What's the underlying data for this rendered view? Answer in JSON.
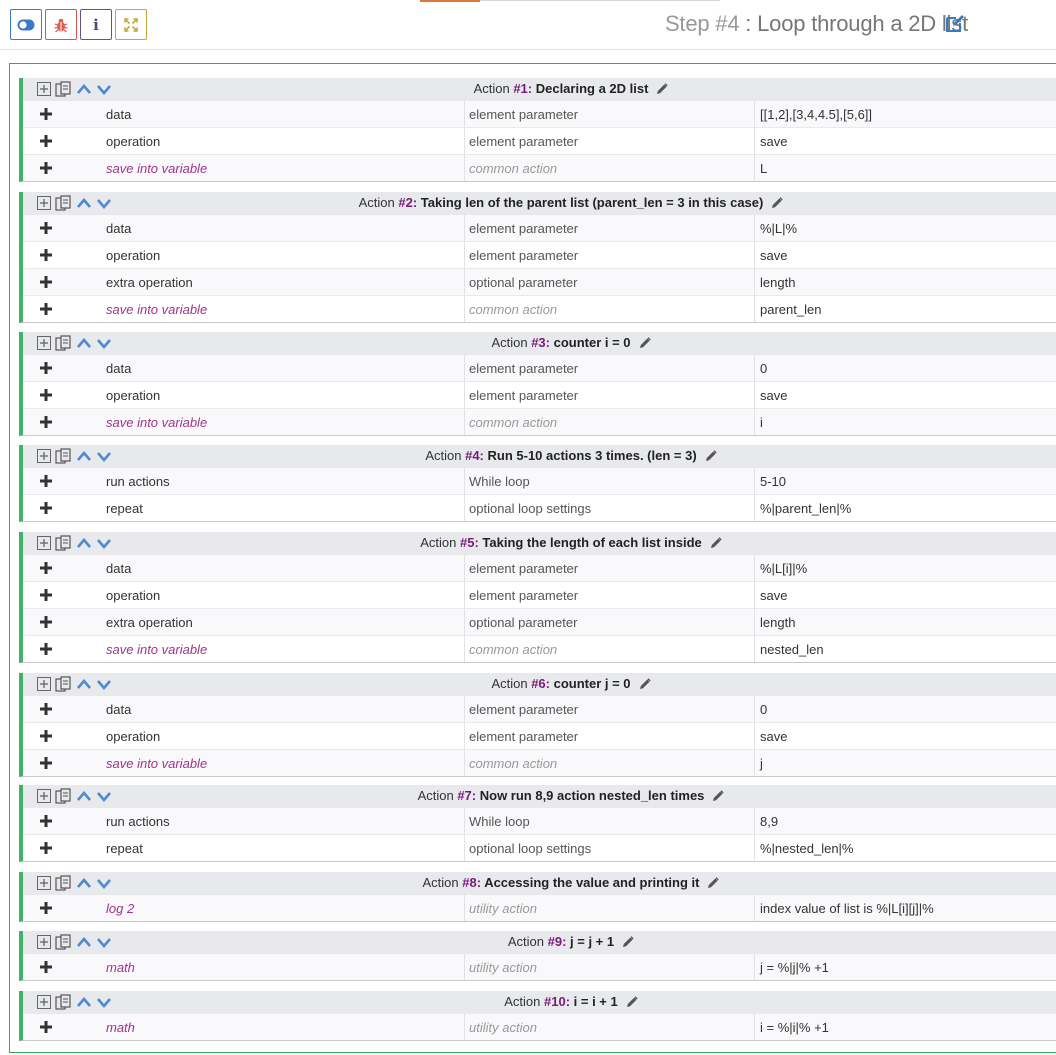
{
  "toolbar": {
    "buttons": [
      {
        "name": "toggle-icon",
        "color": "#3a79c4"
      },
      {
        "name": "bug-icon",
        "color": "#d9534f"
      },
      {
        "name": "info-icon",
        "glyph": "i",
        "color": "#5b5b8a"
      },
      {
        "name": "expand-icon",
        "color": "#c9a43a"
      }
    ]
  },
  "step": {
    "number": "Step #4",
    "separator": " : ",
    "title": "Loop through a 2D list"
  },
  "actions": [
    {
      "label": "Action",
      "num": "#1:",
      "name": "Declaring a 2D list",
      "rows": [
        {
          "field": "data",
          "type": "element parameter",
          "value": "[[1,2],[3,4,4.5],[5,6]]",
          "style": "normal"
        },
        {
          "field": "operation",
          "type": "element parameter",
          "value": "save",
          "style": "normal"
        },
        {
          "field": "save into variable",
          "type": "common action",
          "value": "L",
          "style": "common"
        }
      ]
    },
    {
      "label": "Action",
      "num": "#2:",
      "name": "Taking len of the parent list (parent_len = 3 in this case)",
      "rows": [
        {
          "field": "data",
          "type": "element parameter",
          "value": "%|L|%",
          "style": "normal"
        },
        {
          "field": "operation",
          "type": "element parameter",
          "value": "save",
          "style": "normal"
        },
        {
          "field": "extra operation",
          "type": "optional parameter",
          "value": "length",
          "style": "normal"
        },
        {
          "field": "save into variable",
          "type": "common action",
          "value": "parent_len",
          "style": "common"
        }
      ]
    },
    {
      "label": "Action",
      "num": "#3:",
      "name": "counter i = 0",
      "rows": [
        {
          "field": "data",
          "type": "element parameter",
          "value": "0",
          "style": "normal"
        },
        {
          "field": "operation",
          "type": "element parameter",
          "value": "save",
          "style": "normal"
        },
        {
          "field": "save into variable",
          "type": "common action",
          "value": "i",
          "style": "common"
        }
      ]
    },
    {
      "label": "Action",
      "num": "#4:",
      "name": "Run 5-10 actions 3 times. (len = 3)",
      "rows": [
        {
          "field": "run actions",
          "type": "While loop",
          "value": "5-10",
          "style": "normal"
        },
        {
          "field": "repeat",
          "type": "optional loop settings",
          "value": "%|parent_len|%",
          "style": "normal"
        }
      ]
    },
    {
      "label": "Action",
      "num": "#5:",
      "name": "Taking the length of each list inside",
      "rows": [
        {
          "field": "data",
          "type": "element parameter",
          "value": "%|L[i]|%",
          "style": "normal"
        },
        {
          "field": "operation",
          "type": "element parameter",
          "value": "save",
          "style": "normal"
        },
        {
          "field": "extra operation",
          "type": "optional parameter",
          "value": "length",
          "style": "normal"
        },
        {
          "field": "save into variable",
          "type": "common action",
          "value": "nested_len",
          "style": "common"
        }
      ]
    },
    {
      "label": "Action",
      "num": "#6:",
      "name": "counter j = 0",
      "rows": [
        {
          "field": "data",
          "type": "element parameter",
          "value": "0",
          "style": "normal"
        },
        {
          "field": "operation",
          "type": "element parameter",
          "value": "save",
          "style": "normal"
        },
        {
          "field": "save into variable",
          "type": "common action",
          "value": "j",
          "style": "common"
        }
      ]
    },
    {
      "label": "Action",
      "num": "#7:",
      "name": "Now run 8,9 action nested_len times",
      "rows": [
        {
          "field": "run actions",
          "type": "While loop",
          "value": "8,9",
          "style": "normal"
        },
        {
          "field": "repeat",
          "type": "optional loop settings",
          "value": "%|nested_len|%",
          "style": "normal"
        }
      ]
    },
    {
      "label": "Action",
      "num": "#8:",
      "name": "Accessing the value and printing it",
      "rows": [
        {
          "field": "log 2",
          "type": "utility action",
          "value": "index value of list is %|L[i][j]|%",
          "style": "common"
        }
      ]
    },
    {
      "label": "Action",
      "num": "#9:",
      "name": "j = j + 1",
      "rows": [
        {
          "field": "math",
          "type": "utility action",
          "value": "j = %|j|% +1",
          "style": "common"
        }
      ]
    },
    {
      "label": "Action",
      "num": "#10:",
      "name": "i = i + 1",
      "rows": [
        {
          "field": "math",
          "type": "utility action",
          "value": "i = %|i|% +1",
          "style": "common"
        }
      ]
    }
  ]
}
